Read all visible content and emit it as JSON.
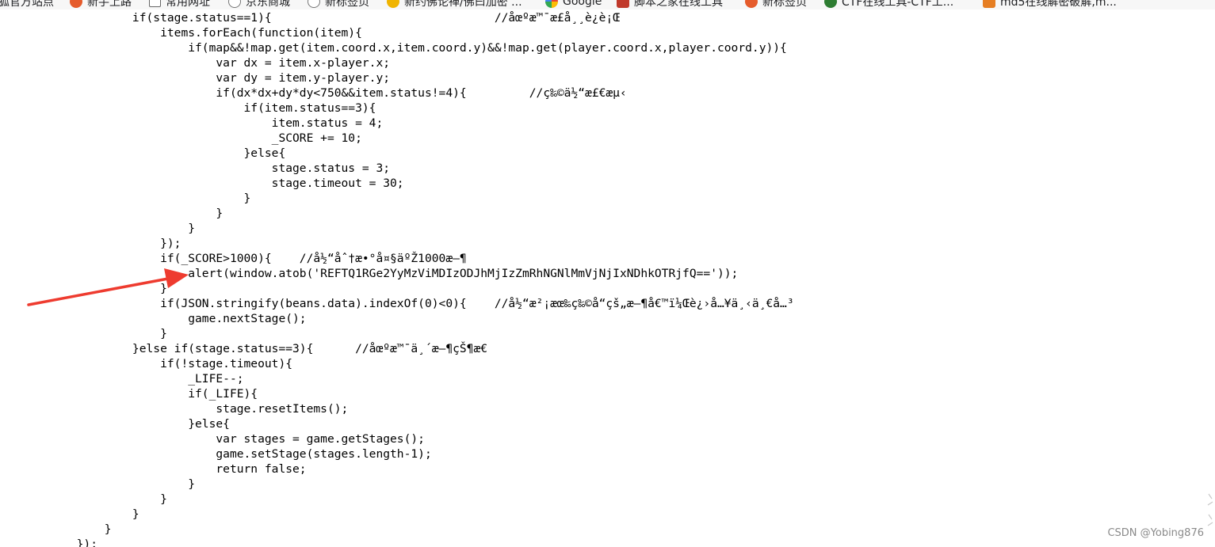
{
  "bookmarks": [
    {
      "label": "狐官方站点",
      "icon": "globe-icon",
      "color": "#e8e8e8"
    },
    {
      "label": "新手上路",
      "icon": "firefox-icon",
      "color": "#e55b2b"
    },
    {
      "label": "常用网址",
      "icon": "folder-icon",
      "color": "#ffffff"
    },
    {
      "label": "京东商城",
      "icon": "globe-icon",
      "color": "#9e9e9e"
    },
    {
      "label": "新标签页",
      "icon": "globe-icon",
      "color": "#9e9e9e"
    },
    {
      "label": "新约佛论禅/佛曰加密 ...",
      "icon": "buddha-icon",
      "color": "#f0b400"
    },
    {
      "label": "Google",
      "icon": "google-icon",
      "color": "#4285f4"
    },
    {
      "label": "脚本之家在线工具",
      "icon": "jb-icon",
      "color": "#c0392b"
    },
    {
      "label": "新标签页",
      "icon": "firefox-icon",
      "color": "#e55b2b"
    },
    {
      "label": "CTF在线工具-CTF工...",
      "icon": "ctf-icon",
      "color": "#2e7d32"
    },
    {
      "label": "md5在线解密破解,m...",
      "icon": "md5-icon",
      "color": "#e67e22"
    }
  ],
  "code_lines": [
    "                   if(stage.status==1){                                //åœºæ™¯æ£å¸¸è¿è¡Œ",
    "                       items.forEach(function(item){",
    "                           if(map&&!map.get(item.coord.x,item.coord.y)&&!map.get(player.coord.x,player.coord.y)){",
    "                               var dx = item.x-player.x;",
    "                               var dy = item.y-player.y;",
    "                               if(dx*dx+dy*dy<750&&item.status!=4){         //ç‰©ä½“æ£€æµ‹",
    "                                   if(item.status==3){",
    "                                       item.status = 4;",
    "                                       _SCORE += 10;",
    "                                   }else{",
    "                                       stage.status = 3;",
    "                                       stage.timeout = 30;",
    "                                   }",
    "                               }",
    "                           }",
    "                       });",
    "                       if(_SCORE>1000){    //å½“åˆ†æ•°å¤§äºŽ1000æ—¶",
    "                           alert(window.atob('REFTQ1RGe2YyMzViMDIzODJhMjIzZmRhNGNlMmVjNjIxNDhkOTRjfQ=='));",
    "                       }",
    "                       if(JSON.stringify(beans.data).indexOf(0)<0){    //å½“æ²¡æœ‰ç‰©å“çš„æ—¶å€™ï¼Œè¿›å…¥ä¸‹ä¸€å…³",
    "                           game.nextStage();",
    "                       }",
    "                   }else if(stage.status==3){      //åœºæ™¯ä¸´æ—¶çŠ¶æ€",
    "                       if(!stage.timeout){",
    "                           _LIFE--;",
    "                           if(_LIFE){",
    "                               stage.resetItems();",
    "                           }else{",
    "                               var stages = game.getStages();",
    "                               game.setStage(stages.length-1);",
    "                               return false;",
    "                           }",
    "                       }",
    "                   }",
    "               }",
    "           });"
  ],
  "watermark": "CSDN @Yobing876",
  "annotation": {
    "arrow_color": "#ee3b2f",
    "arrow_icon": "red-arrow-icon"
  }
}
